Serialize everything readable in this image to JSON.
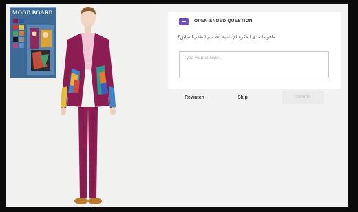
{
  "moodboard": {
    "title": "MOOD BOARD",
    "swatches": [
      "#7a1f5c",
      "#2b5a9b",
      "#c43a3a",
      "#e0c640",
      "#4fa06b",
      "#d07a2d",
      "#1d1d1d",
      "#8f8f8f",
      "#b3487d",
      "#5c8fcf"
    ]
  },
  "question": {
    "type_label": "OPEN-ENDED QUESTION",
    "text": "ماهو ما مدى الفكرة الإبداعية بتصميم الطقم السابق؟",
    "answer_placeholder": "Type your answer...",
    "answer_value": ""
  },
  "actions": {
    "rewatch_label": "Rewatch",
    "skip_label": "Skip",
    "submit_label": "Submit"
  },
  "colors": {
    "accent": "#6f4ec4",
    "suit": "#8c1d52",
    "panel_bg": "#f2f2f2"
  }
}
